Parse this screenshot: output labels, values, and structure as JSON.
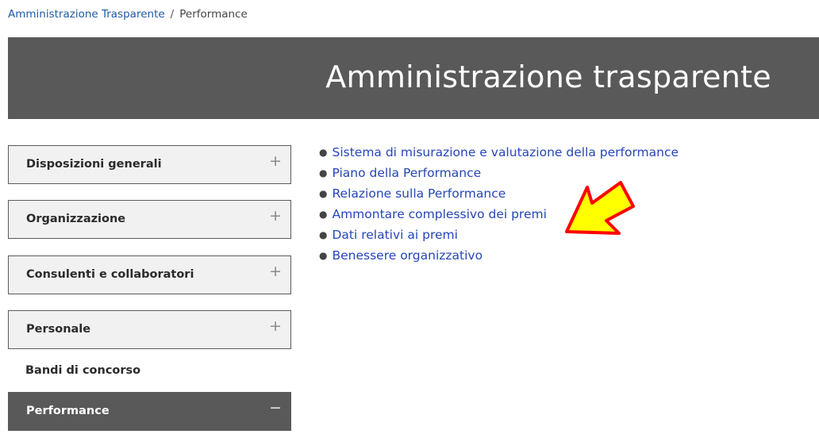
{
  "breadcrumb": {
    "parent": "Amministrazione Trasparente",
    "separator": "/",
    "current": "Performance"
  },
  "hero": {
    "title": "Amministrazione trasparente"
  },
  "sidebar": {
    "sections": [
      {
        "label": "Disposizioni generali",
        "toggle": "+"
      },
      {
        "label": "Organizzazione",
        "toggle": "+"
      },
      {
        "label": "Consulenti e collaboratori",
        "toggle": "+"
      },
      {
        "label": "Personale",
        "toggle": "+"
      }
    ],
    "bandi": "Bandi di concorso",
    "active": {
      "label": "Performance",
      "toggle": "−"
    }
  },
  "main": {
    "links": [
      "Sistema di misurazione e valutazione della performance",
      "Piano della Performance",
      "Relazione sulla Performance",
      "Ammontare complessivo dei premi",
      "Dati relativi ai premi",
      "Benessere organizzativo"
    ]
  },
  "colors": {
    "arrow_fill": "#ffff00",
    "arrow_stroke": "#ff0000",
    "link": "#2646b8",
    "dark_bg": "#595959"
  }
}
